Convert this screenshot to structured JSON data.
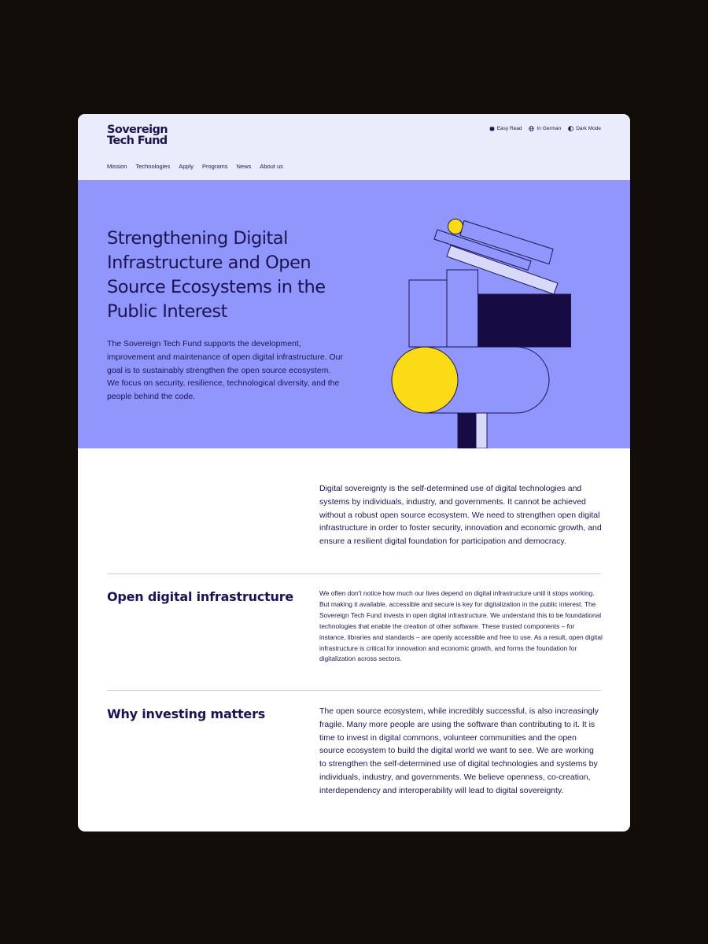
{
  "brand": {
    "line1": "Sovereign",
    "line2": "Tech Fund"
  },
  "utilities": [
    {
      "label": "Easy Read",
      "icon": "easy-read-icon"
    },
    {
      "label": "In German",
      "icon": "globe-icon"
    },
    {
      "label": "Dark Mode",
      "icon": "contrast-icon"
    }
  ],
  "nav": [
    "Mission",
    "Technologies",
    "Apply",
    "Programs",
    "News",
    "About us"
  ],
  "hero": {
    "title": "Strengthening Digital Infrastructure and Open Source Ecosystems in the Public Interest",
    "text": "The Sovereign Tech Fund supports the development, improvement and maintenance of open digital infrastructure. Our goal is to sustainably strengthen the open source ecosystem. We focus on security, resilience, technological diversity, and the people behind the code."
  },
  "intro": "Digital sovereignty is the self-determined use of digital technologies and systems by individuals, industry, and governments. It cannot be achieved without a robust open source ecosystem. We need to strengthen open digital infrastructure in order to foster security, innovation and economic growth, and ensure a resilient digital foundation for participation and democracy.",
  "sections": [
    {
      "title": "Open digital infrastructure",
      "text": "We often don't notice how much our lives depend on digital infrastructure until it stops working. But making it available, accessible and secure is key for digitalization in the public interest. The Sovereign Tech Fund invests in open digital infrastructure. We understand this to be foundational technologies that enable the creation of other software. These trusted components – for instance, libraries and standards – are openly accessible and free to use. As a result, open digital infrastructure is critical for innovation and economic growth, and forms the foundation for digitalization across sectors."
    },
    {
      "title": "Why investing matters",
      "text": "The open source ecosystem, while incredibly successful, is also increasingly fragile. Many more people are using the software than contributing to it. It is time to invest in digital commons, volunteer communities and the open source ecosystem to build the digital world we want to see. We are working to strengthen the self-determined use of digital technologies and systems by individuals, industry, and governments. We believe openness, co-creation, interdependency and interoperability will lead to digital sovereignty."
    }
  ],
  "colors": {
    "page_background": "#130d09",
    "header_background": "#ebecfb",
    "hero_background": "#9196fc",
    "navy": "#1b1452",
    "yellow": "#fbda16",
    "lavender": "#d8d9fa"
  }
}
